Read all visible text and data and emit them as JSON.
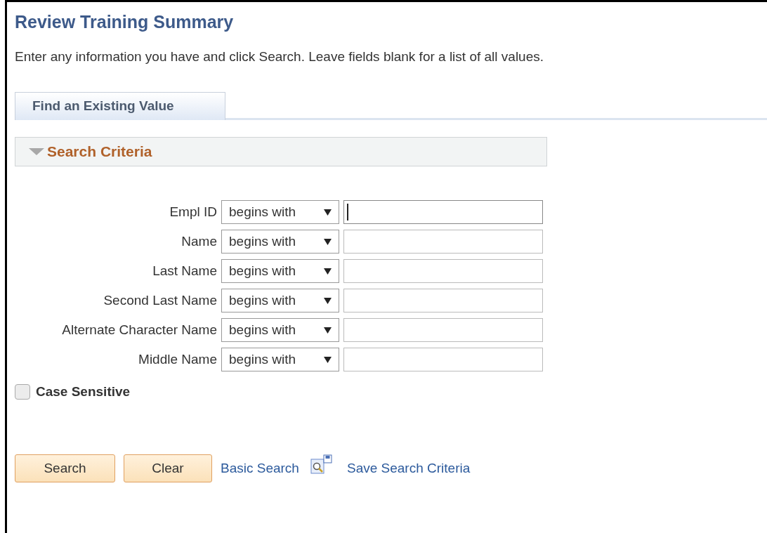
{
  "page": {
    "title": "Review Training Summary",
    "instructions": "Enter any information you have and click Search. Leave fields blank for a list of all values."
  },
  "tabs": [
    {
      "label": "Find an Existing Value",
      "selected": true
    }
  ],
  "section": {
    "title": "Search Criteria",
    "expanded": true
  },
  "fields": [
    {
      "label": "Empl ID",
      "operator": "begins with",
      "focused": true
    },
    {
      "label": "Name",
      "operator": "begins with",
      "focused": false
    },
    {
      "label": "Last Name",
      "operator": "begins with",
      "focused": false
    },
    {
      "label": "Second Last Name",
      "operator": "begins with",
      "focused": false
    },
    {
      "label": "Alternate Character Name",
      "operator": "begins with",
      "focused": false
    },
    {
      "label": "Middle Name",
      "operator": "begins with",
      "focused": false
    }
  ],
  "case_sensitive": {
    "label": "Case Sensitive",
    "checked": false
  },
  "buttons": [
    "Search",
    "Clear"
  ],
  "links": {
    "basic_search": "Basic Search",
    "save_criteria": "Save Search Criteria"
  }
}
